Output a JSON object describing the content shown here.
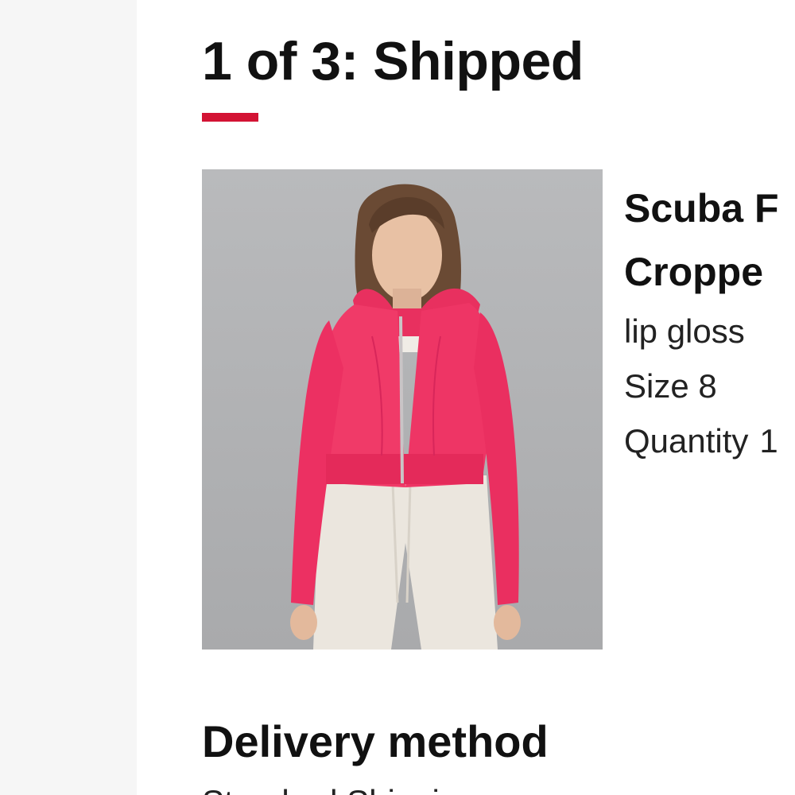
{
  "shipment": {
    "title": "1 of 3: Shipped",
    "accent_color": "#d31334"
  },
  "product": {
    "image_icon": "product-photo-pink-cropped-hoodie",
    "name_line1": "Scuba F",
    "name_line2": "Croppe",
    "color": "lip gloss",
    "size": "Size 8",
    "quantity_label": "Quantity",
    "quantity_value": "1"
  },
  "delivery": {
    "heading": "Delivery method",
    "value": "Standard Shipping"
  }
}
